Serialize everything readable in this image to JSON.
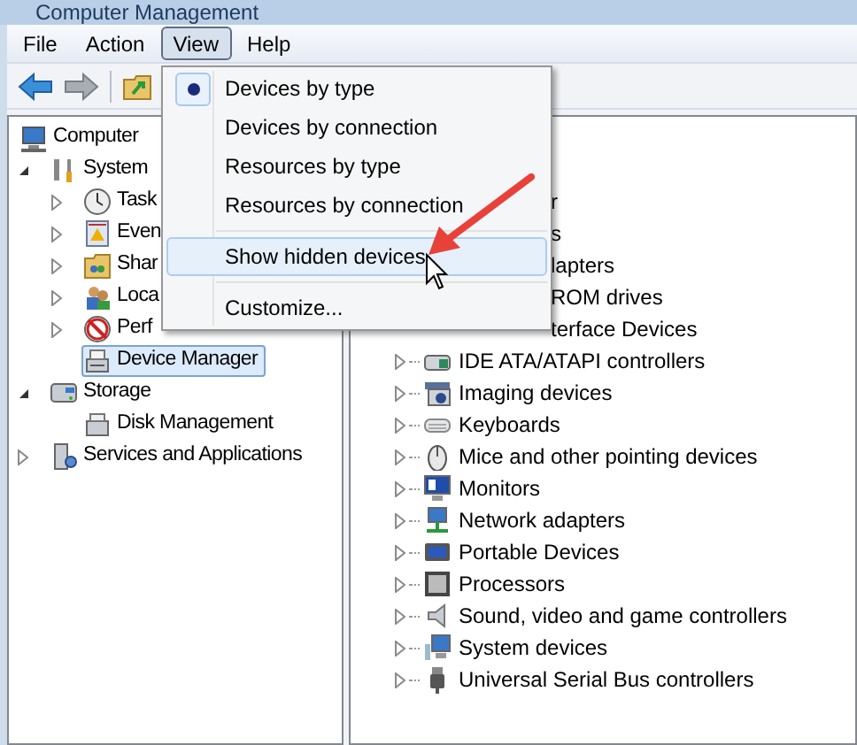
{
  "window": {
    "title": "Computer Management"
  },
  "menubar": [
    {
      "label": "File",
      "selected": false
    },
    {
      "label": "Action",
      "selected": false
    },
    {
      "label": "View",
      "selected": true
    },
    {
      "label": "Help",
      "selected": false
    }
  ],
  "view_menu": [
    {
      "kind": "item",
      "label": "Devices by type",
      "selected": true,
      "hovered": false
    },
    {
      "kind": "item",
      "label": "Devices by connection",
      "selected": false,
      "hovered": false
    },
    {
      "kind": "item",
      "label": "Resources by type",
      "selected": false,
      "hovered": false
    },
    {
      "kind": "item",
      "label": "Resources by connection",
      "selected": false,
      "hovered": false
    },
    {
      "kind": "separator"
    },
    {
      "kind": "item",
      "label": "Show hidden devices",
      "selected": false,
      "hovered": true
    },
    {
      "kind": "separator"
    },
    {
      "kind": "item",
      "label": "Customize...",
      "selected": false,
      "hovered": false
    }
  ],
  "console_tree": [
    {
      "kind": "root",
      "label": "Computer",
      "selected": false,
      "children": [
        {
          "kind": "branch",
          "label": "System",
          "expanded": true,
          "selected": false,
          "children": [
            {
              "kind": "branch",
              "label": "Task",
              "expanded": false,
              "selected": false
            },
            {
              "kind": "branch",
              "label": "Even",
              "expanded": false,
              "selected": false
            },
            {
              "kind": "branch",
              "label": "Shar",
              "expanded": false,
              "selected": false
            },
            {
              "kind": "branch",
              "label": "Loca",
              "expanded": false,
              "selected": false
            },
            {
              "kind": "branch",
              "label": "Perf",
              "expanded": false,
              "selected": false
            },
            {
              "kind": "leaf",
              "label": "Device Manager",
              "selected": true
            }
          ]
        },
        {
          "kind": "branch",
          "label": "Storage",
          "expanded": true,
          "selected": false,
          "children": [
            {
              "kind": "leaf",
              "label": "Disk Management",
              "selected": false
            }
          ]
        },
        {
          "kind": "branch",
          "label": "Services and Applications",
          "expanded": false,
          "selected": false
        }
      ]
    }
  ],
  "device_list": [
    {
      "kind": "partial",
      "label": "r"
    },
    {
      "kind": "partial",
      "label": "s"
    },
    {
      "kind": "partial",
      "label": "lapters"
    },
    {
      "kind": "partial",
      "label": "ROM drives"
    },
    {
      "kind": "partial",
      "label": "terface Devices"
    },
    {
      "kind": "category",
      "label": "IDE ATA/ATAPI controllers"
    },
    {
      "kind": "category",
      "label": "Imaging devices"
    },
    {
      "kind": "category",
      "label": "Keyboards"
    },
    {
      "kind": "category",
      "label": "Mice and other pointing devices"
    },
    {
      "kind": "category",
      "label": "Monitors"
    },
    {
      "kind": "category",
      "label": "Network adapters"
    },
    {
      "kind": "category",
      "label": "Portable Devices"
    },
    {
      "kind": "category",
      "label": "Processors"
    },
    {
      "kind": "category",
      "label": "Sound, video and game controllers"
    },
    {
      "kind": "category",
      "label": "System devices"
    },
    {
      "kind": "category",
      "label": "Universal Serial Bus controllers"
    }
  ]
}
